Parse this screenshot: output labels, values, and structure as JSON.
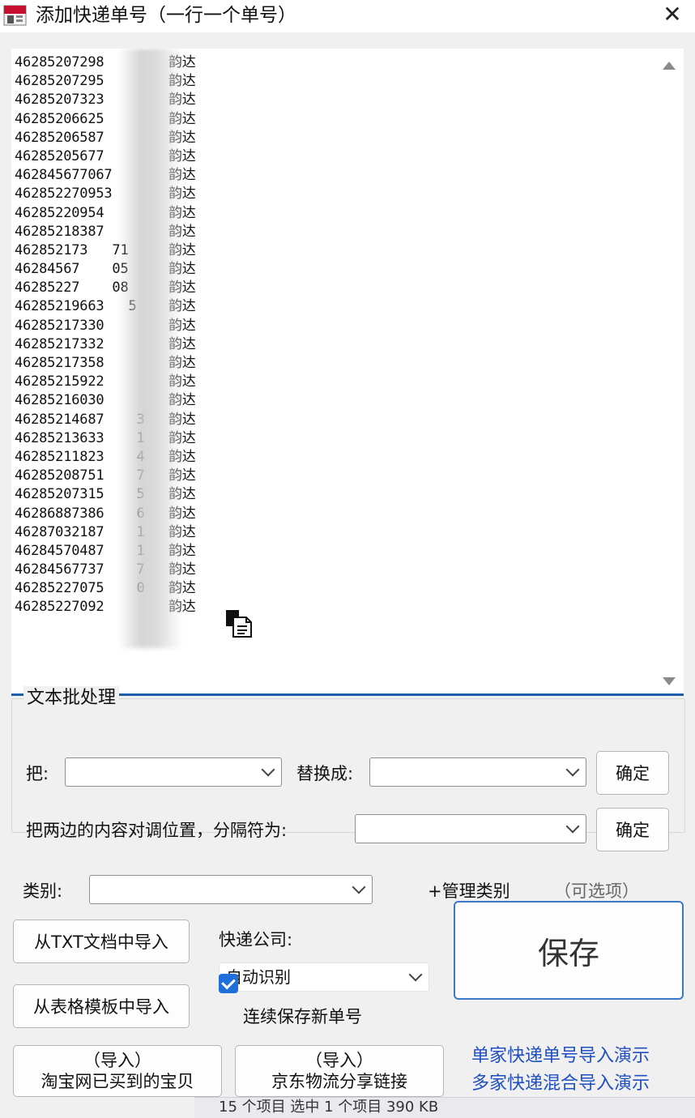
{
  "window": {
    "title": "添加快递单号（一行一个单号）",
    "close": "✕"
  },
  "entries": [
    {
      "number": "46285207298",
      "carrier": "韵达"
    },
    {
      "number": "46285207295",
      "carrier": "韵达"
    },
    {
      "number": "46285207323",
      "carrier": "韵达"
    },
    {
      "number": "46285206625",
      "carrier": "韵达"
    },
    {
      "number": "46285206587",
      "carrier": "韵达"
    },
    {
      "number": "46285205677",
      "carrier": "韵达"
    },
    {
      "number": "462845677067",
      "carrier": "韵达"
    },
    {
      "number": "462852270953",
      "carrier": "韵达"
    },
    {
      "number": "46285220954",
      "carrier": "韵达"
    },
    {
      "number": "46285218387",
      "carrier": "韵达"
    },
    {
      "number": "462852173   71",
      "carrier": "韵达"
    },
    {
      "number": "46284567    05",
      "carrier": "韵达"
    },
    {
      "number": "46285227    08",
      "carrier": "韵达"
    },
    {
      "number": "46285219663   5",
      "carrier": "韵达"
    },
    {
      "number": "46285217330",
      "carrier": "韵达"
    },
    {
      "number": "46285217332",
      "carrier": "韵达"
    },
    {
      "number": "46285217358",
      "carrier": "韵达"
    },
    {
      "number": "46285215922",
      "carrier": "韵达"
    },
    {
      "number": "46285216030",
      "carrier": "韵达"
    },
    {
      "number": "46285214687    3",
      "carrier": "韵达"
    },
    {
      "number": "46285213633    1",
      "carrier": "韵达"
    },
    {
      "number": "46285211823    4",
      "carrier": "韵达"
    },
    {
      "number": "46285208751    7",
      "carrier": "韵达"
    },
    {
      "number": "46285207315    5",
      "carrier": "韵达"
    },
    {
      "number": "46286887386    6",
      "carrier": "韵达"
    },
    {
      "number": "46287032187    1",
      "carrier": "韵达"
    },
    {
      "number": "46284570487    1",
      "carrier": "韵达"
    },
    {
      "number": "46284567737    7",
      "carrier": "韵达"
    },
    {
      "number": "46285227075    0",
      "carrier": "韵达"
    },
    {
      "number": "46285227092",
      "carrier": "韵达"
    }
  ],
  "batch": {
    "title": "文本批处理",
    "replace_from_label": "把:",
    "replace_to_label": "替换成:",
    "confirm_label": "确定",
    "swap_label": "把两边的内容对调位置，分隔符为:",
    "confirm2_label": "确定"
  },
  "category": {
    "label": "类别:",
    "manage_label": "+管理类别",
    "optional_label": "（可选项）"
  },
  "import": {
    "txt_label": "从TXT文档中导入",
    "table_label": "从表格模板中导入",
    "taobao_line1": "（导入）",
    "taobao_line2": "淘宝网已买到的宝贝",
    "jd_line1": "（导入）",
    "jd_line2": "京东物流分享链接"
  },
  "courier": {
    "label": "快递公司:",
    "selected": "自动识别",
    "continuous_label": "连续保存新单号",
    "continuous_checked": true
  },
  "save_label": "保存",
  "links": {
    "single_demo": "单家快递单号导入演示",
    "multi_demo": "多家快递混合导入演示"
  },
  "status_bar": {
    "text": "15 个项目    选中 1 个项目  390 KB"
  },
  "colors": {
    "accent": "#1b5fa8",
    "link": "#1f4fc1",
    "checkbox": "#1e6fd9"
  }
}
